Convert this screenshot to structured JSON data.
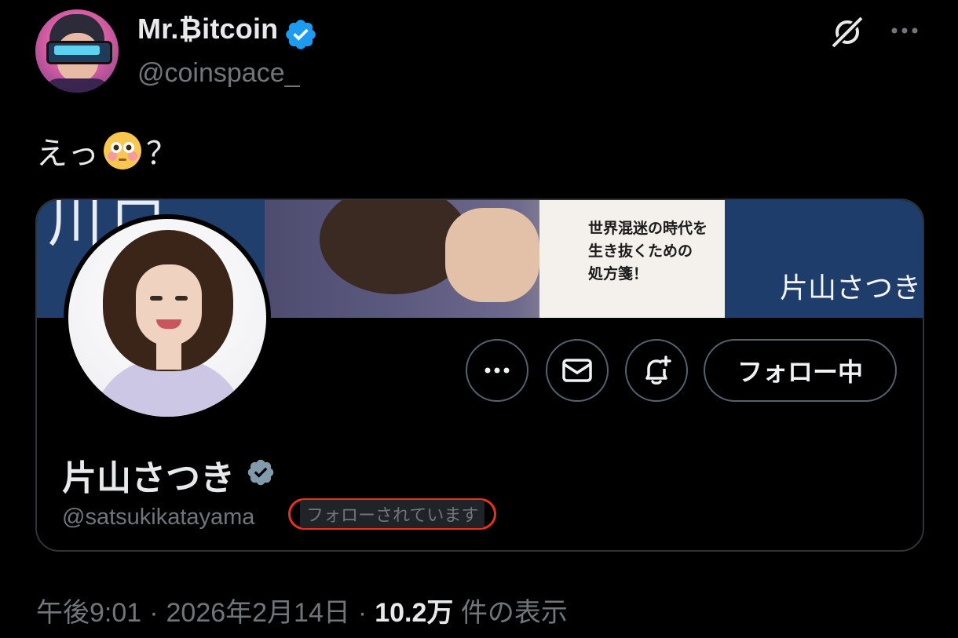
{
  "author": {
    "name": "Mr.₿itcoin",
    "handle": "@coinspace_",
    "verified": true
  },
  "tweet": {
    "text_prefix": "えっ",
    "emoji": "flushed-face",
    "text_suffix": "？"
  },
  "profile_card": {
    "banner": {
      "tagline_line1": "世界混迷の時代を",
      "tagline_line2": "生き抜くための",
      "tagline_line3": "処方箋！",
      "name": "片山さつき"
    },
    "name": "片山さつき",
    "verified_badge": "gray-check",
    "handle": "@satsukikatayama",
    "follows_you": "フォローされています",
    "following_button": "フォロー中"
  },
  "meta": {
    "time": "午後9:01",
    "date": "2026年2月14日",
    "views": "10.2万",
    "views_label": "件の表示"
  },
  "colors": {
    "background": "#000000",
    "text": "#e7e9ea",
    "secondary": "#71767b",
    "verified_blue": "#1d9bf0",
    "highlight_red": "#e8321e"
  }
}
